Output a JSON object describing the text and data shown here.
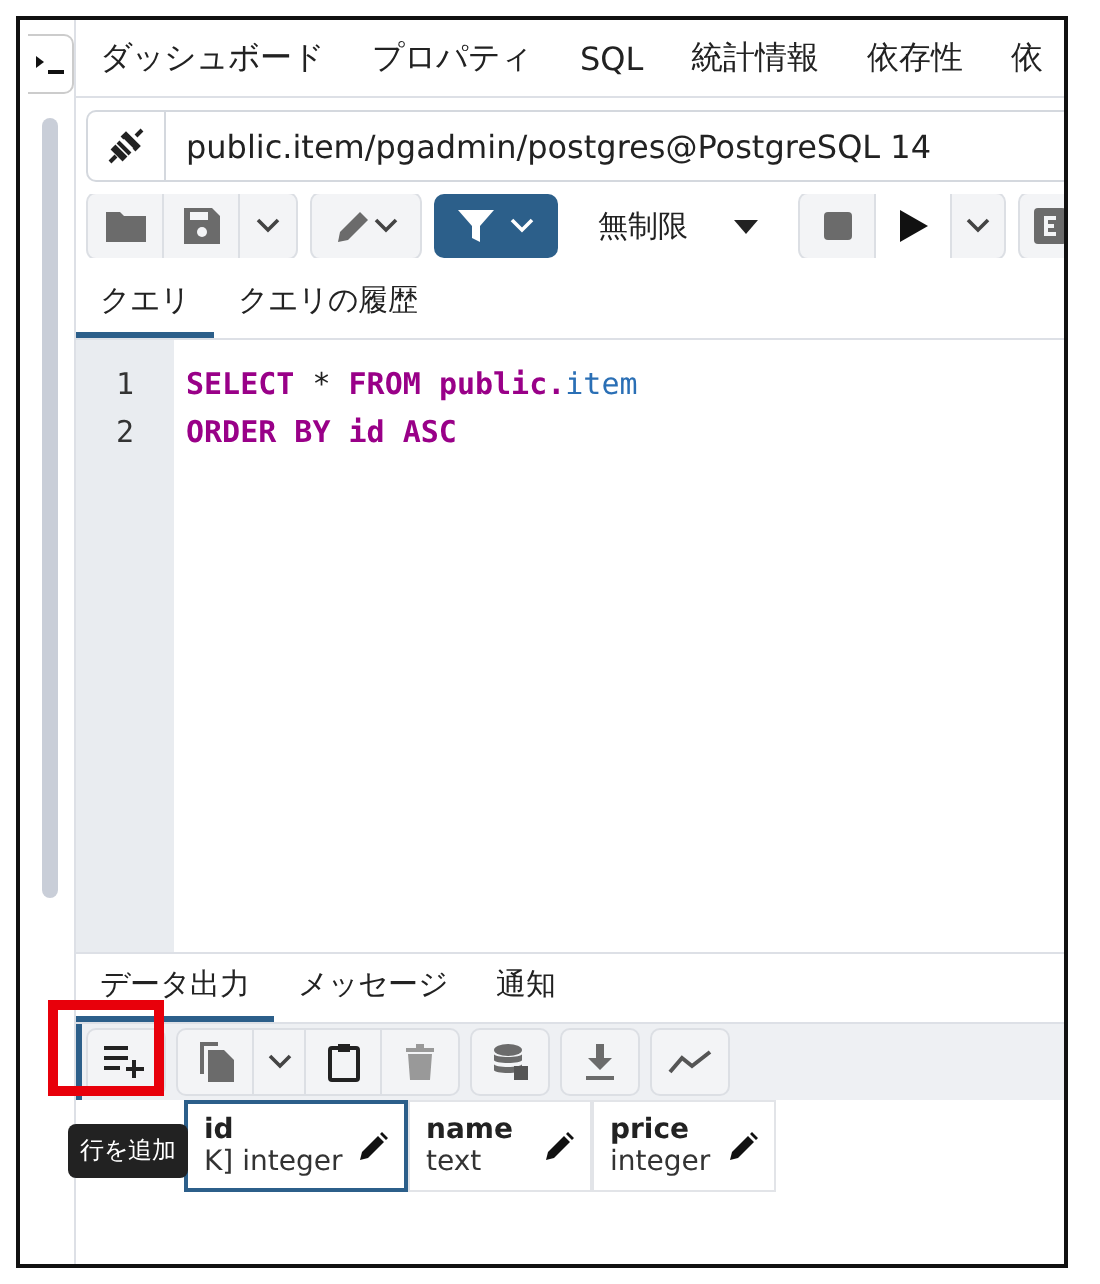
{
  "top_tabs": [
    {
      "label": "ダッシュボード"
    },
    {
      "label": "プロパティ"
    },
    {
      "label": "SQL"
    },
    {
      "label": "統計情報"
    },
    {
      "label": "依存性"
    },
    {
      "label": "依"
    }
  ],
  "connection": {
    "label": "public.item/pgadmin/postgres@PostgreSQL 14"
  },
  "toolbar": {
    "limit": "無制限",
    "filter_active": true
  },
  "query_tabs": [
    {
      "label": "クエリ",
      "selected": true
    },
    {
      "label": "クエリの履歴",
      "selected": false
    }
  ],
  "editor": {
    "lines": [
      {
        "number": "1",
        "tokens": [
          {
            "text": "SELECT ",
            "kind": "keyword"
          },
          {
            "text": "* ",
            "kind": "operator"
          },
          {
            "text": "FROM ",
            "kind": "keyword"
          },
          {
            "text": "public.",
            "kind": "keyword"
          },
          {
            "text": "item",
            "kind": "identifier"
          }
        ]
      },
      {
        "number": "2",
        "tokens": [
          {
            "text": "ORDER BY id ASC",
            "kind": "keyword"
          }
        ]
      }
    ]
  },
  "result_tabs": [
    {
      "label": "データ出力",
      "selected": true
    },
    {
      "label": "メッセージ",
      "selected": false
    },
    {
      "label": "通知",
      "selected": false
    }
  ],
  "columns": [
    {
      "name": "id",
      "type": "K] integer",
      "selected": true
    },
    {
      "name": "name",
      "type": "text",
      "selected": false
    },
    {
      "name": "price",
      "type": "integer",
      "selected": false
    }
  ],
  "tooltip": "行を追加"
}
